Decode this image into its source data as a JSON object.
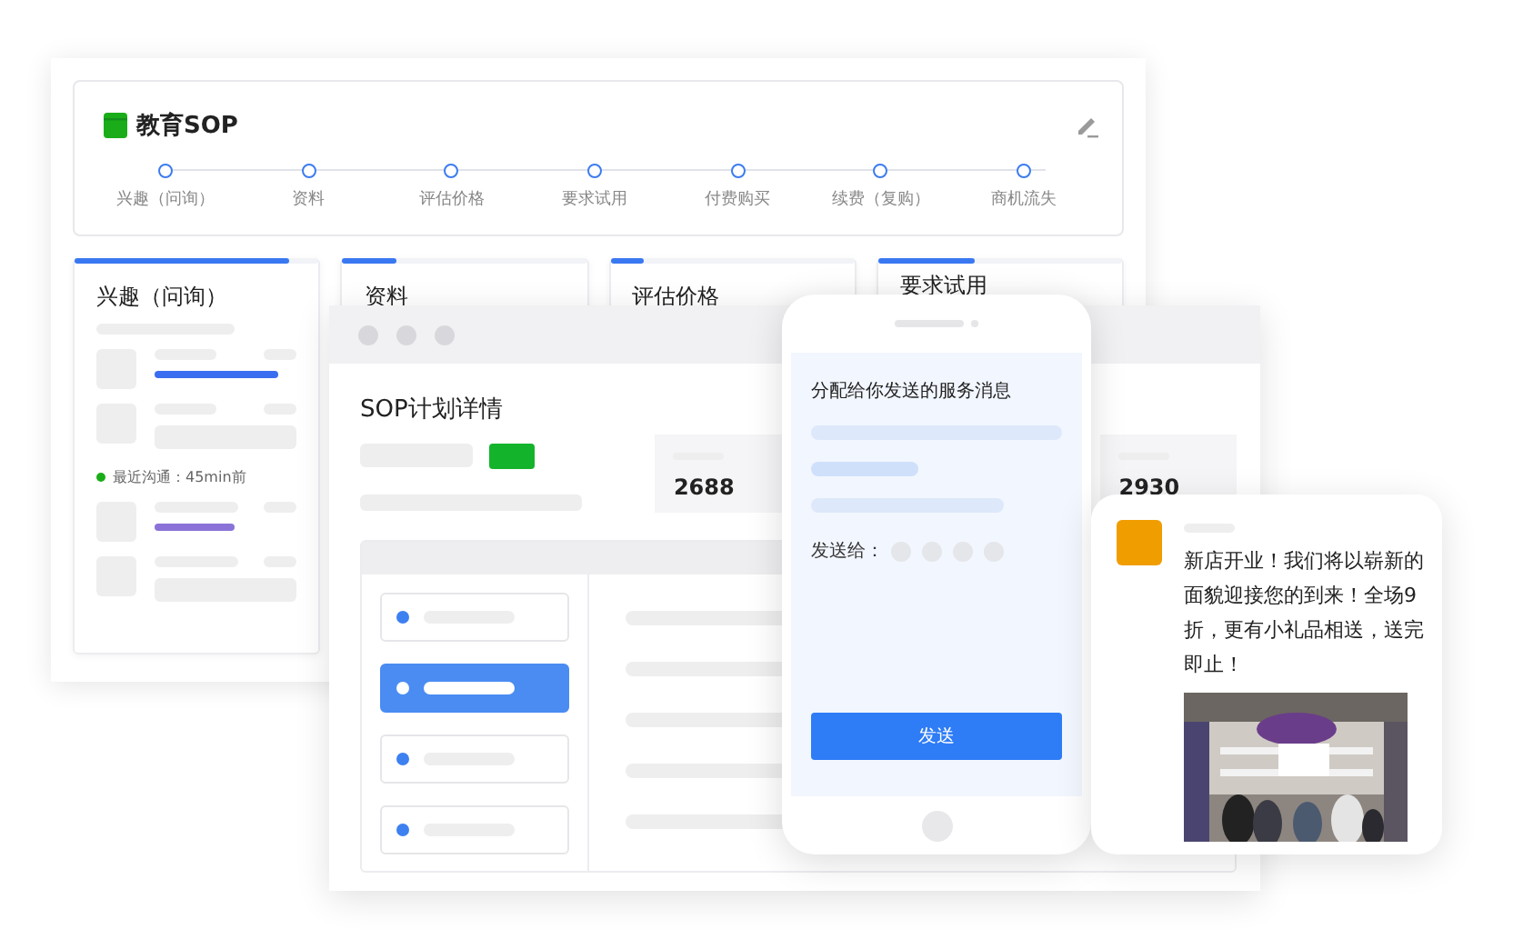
{
  "sop": {
    "title": "教育SOP",
    "steps": [
      "兴趣（问询）",
      "资料",
      "评估价格",
      "要求试用",
      "付费购买",
      "续费（复购）",
      "商机流失"
    ]
  },
  "stages": [
    {
      "title": "兴趣（问询）",
      "level": 0.88
    },
    {
      "title": "资料",
      "level": 0.22
    },
    {
      "title": "评估价格",
      "level": 0.14
    },
    {
      "title": "要求试用",
      "level": 0.4
    }
  ],
  "stage_card": {
    "status": "最近沟通：45min前"
  },
  "detail_window": {
    "title": "SOP计划详情",
    "stats": [
      "2688",
      "2930"
    ],
    "list": [
      {
        "selected": false
      },
      {
        "selected": true
      },
      {
        "selected": false
      },
      {
        "selected": false
      }
    ]
  },
  "phone": {
    "title": "分配给你发送的服务消息",
    "recipients_label": "发送给：",
    "button": "发送"
  },
  "message": {
    "text": "新店开业！我们将以崭新的面貌迎接您的到来！全场9折，更有小礼品相送，送完即止！"
  }
}
